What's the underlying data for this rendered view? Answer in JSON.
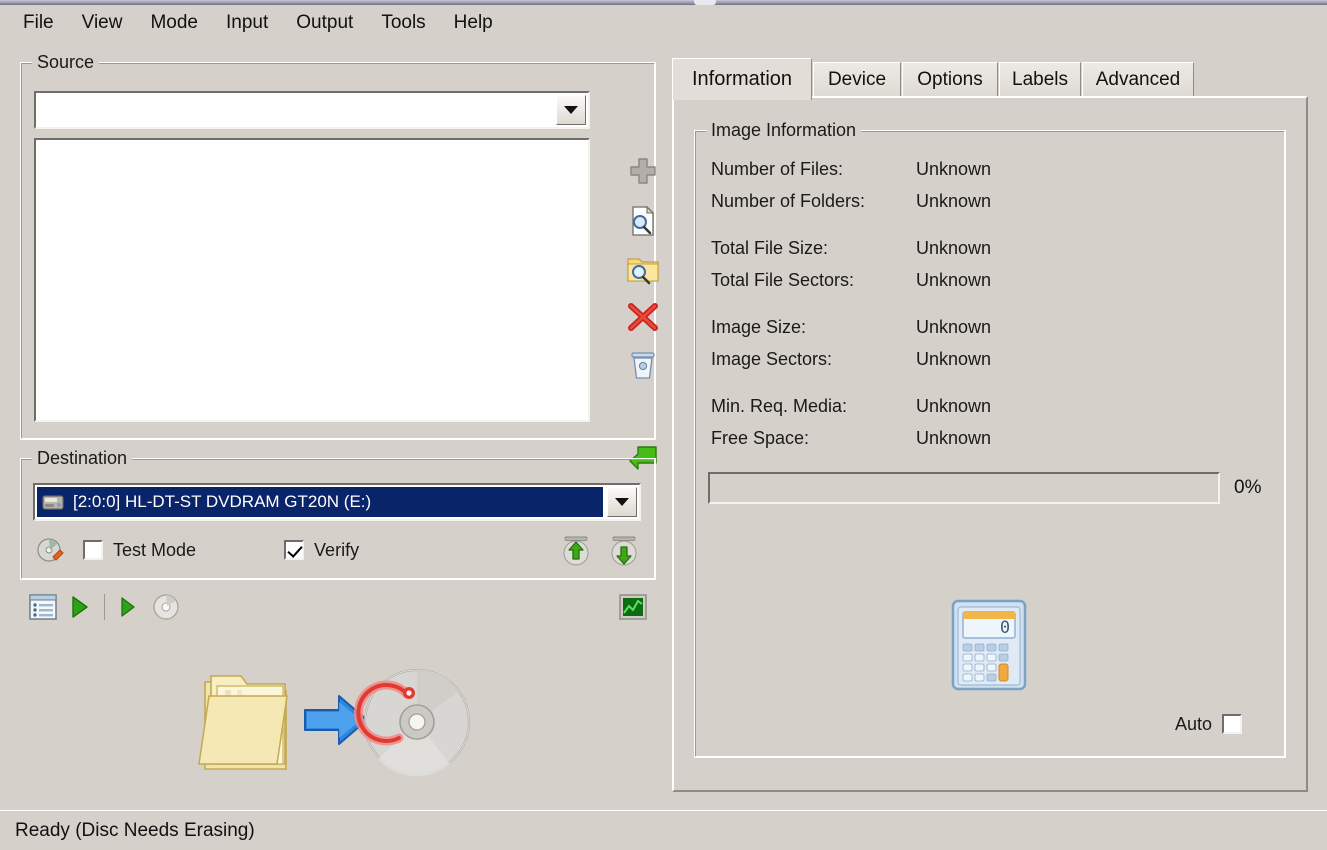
{
  "window": {
    "menu": [
      "File",
      "View",
      "Mode",
      "Input",
      "Output",
      "Tools",
      "Help"
    ]
  },
  "source": {
    "title": "Source",
    "combo_value": "",
    "combo_placeholder": "",
    "list_items": [],
    "icons": [
      {
        "name": "add-icon",
        "tip": "Add"
      },
      {
        "name": "browse-file-icon",
        "tip": "Browse for a file"
      },
      {
        "name": "browse-folder-icon",
        "tip": "Browse for a folder"
      },
      {
        "name": "remove-icon",
        "tip": "Remove"
      },
      {
        "name": "clear-icon",
        "tip": "Clear"
      },
      {
        "name": "import-icon",
        "tip": "Import"
      }
    ]
  },
  "destination": {
    "title": "Destination",
    "device": "[2:0:0] HL-DT-ST DVDRAM GT20N (E:)",
    "test_mode_label": "Test Mode",
    "test_mode_checked": false,
    "verify_label": "Verify",
    "verify_checked": true,
    "eject_tip": "Eject",
    "load_tip": "Load"
  },
  "toolbar": {
    "items": [
      {
        "name": "build-queue-icon"
      },
      {
        "name": "play-icon"
      },
      {
        "name": "play-small-icon"
      },
      {
        "name": "disc-layout-icon"
      },
      {
        "name": "graph-icon"
      }
    ]
  },
  "mode_illustration": {
    "name": "folder-to-disc-illustration",
    "from": "folder",
    "to": "disc"
  },
  "tabs": [
    {
      "label": "Information",
      "active": true
    },
    {
      "label": "Device",
      "active": false
    },
    {
      "label": "Options",
      "active": false
    },
    {
      "label": "Labels",
      "active": false
    },
    {
      "label": "Advanced",
      "active": false
    }
  ],
  "image_information": {
    "title": "Image Information",
    "rows": [
      {
        "label": "Number of Files:",
        "value": "Unknown",
        "gap": false
      },
      {
        "label": "Number of Folders:",
        "value": "Unknown",
        "gap": false
      },
      {
        "label": "Total File Size:",
        "value": "Unknown",
        "gap": true
      },
      {
        "label": "Total File Sectors:",
        "value": "Unknown",
        "gap": false
      },
      {
        "label": "Image Size:",
        "value": "Unknown",
        "gap": true
      },
      {
        "label": "Image Sectors:",
        "value": "Unknown",
        "gap": false
      },
      {
        "label": "Min. Req. Media:",
        "value": "Unknown",
        "gap": true
      },
      {
        "label": "Free Space:",
        "value": "Unknown",
        "gap": false
      }
    ],
    "progress_percent": "0%",
    "progress_value": 0,
    "calculate_icon": "calculator-icon",
    "auto_label": "Auto",
    "auto_checked": false
  },
  "statusbar": {
    "text": "Ready (Disc Needs Erasing)"
  },
  "colors": {
    "background": "#d5d1ca",
    "selection_blue": "#0a246a",
    "accent_green": "#3a9b18",
    "titlebar": "#6f6e84"
  }
}
